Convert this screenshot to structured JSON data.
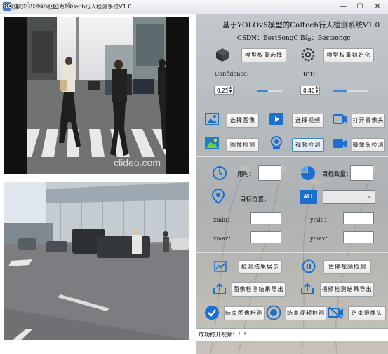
{
  "window": {
    "title": "基于YOLOv5模型的Caltech行人检测系统V1.0",
    "watermark": "Reproducao parada",
    "min_glyph": "—",
    "max_glyph": "☐",
    "close_glyph": "✕"
  },
  "video_top": {
    "watermark": "clideo.com"
  },
  "header": {
    "title": "基于YOLOv5模型的Caltech行人检测系统V1.0",
    "csdn": "CSDN：BestSongC",
    "bilibili": "B站：Bestsongc"
  },
  "model": {
    "select_weights": "模型权重选择",
    "init_weights": "模型权重初始化"
  },
  "params": {
    "confidence_label": "Confidence:",
    "confidence_value": "0.25",
    "confidence_level": 0.45,
    "iou_label": "IOU：",
    "iou_value": "0.40",
    "iou_level": 0.42
  },
  "controls": {
    "select_image": "选择图像",
    "select_video": "选择视频",
    "open_camera": "打开摄像头",
    "image_detect": "图像检测",
    "video_detect": "视频检测",
    "camera_detect": "摄像头检测"
  },
  "stats": {
    "time_label": "用时：",
    "count_label": "目标数量：",
    "position_label": "目标位置：",
    "all_badge": "ALL",
    "xmin_label": "xmin：",
    "ymin_label": "ymin：",
    "xmax_label": "xmax：",
    "ymax_label": "ymax："
  },
  "actions": {
    "show_results": "检测结果展示",
    "pause_video": "暂停视频检测",
    "export_image": "图像检测结果导出",
    "export_video": "视频检测结果导出",
    "end_image": "结束图像检测",
    "end_video": "结束视频检测",
    "end_camera": "结束摄像头"
  },
  "status": {
    "message": "成功打开视频！！！"
  },
  "colors": {
    "accent": "#3c86d8",
    "panel": "#b5bcbf"
  }
}
